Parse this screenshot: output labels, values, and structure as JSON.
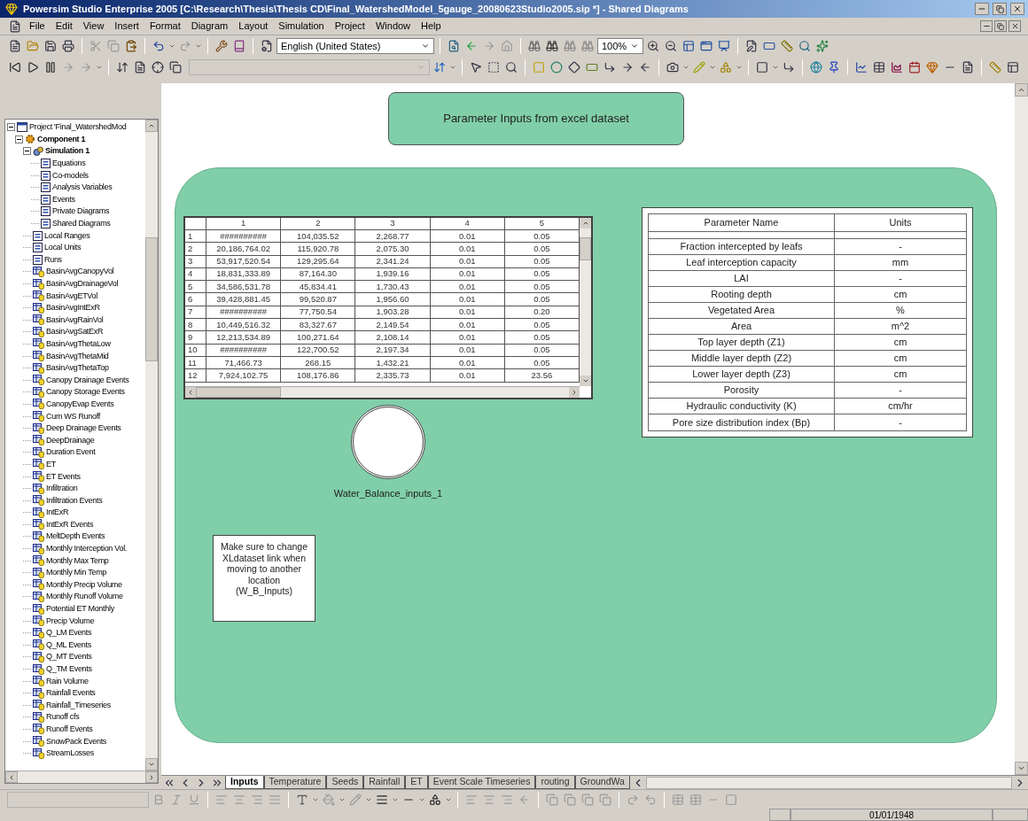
{
  "window": {
    "title": "Powersim Studio Enterprise 2005 [C:\\Research\\Thesis\\Thesis CD\\Final_WatershedModel_5gauge_20080623Studio2005.sip *] - Shared Diagrams"
  },
  "menu": [
    "File",
    "Edit",
    "View",
    "Insert",
    "Format",
    "Diagram",
    "Layout",
    "Simulation",
    "Project",
    "Window",
    "Help"
  ],
  "toolbar": {
    "language": "English (United States)",
    "zoom": "100%"
  },
  "project_tree": [
    {
      "label": "Project 'Final_WatershedMod",
      "kind": "project",
      "expanded": true,
      "children": [
        {
          "label": "Component 1",
          "kind": "component",
          "expanded": true,
          "children": [
            {
              "label": "Simulation 1",
              "kind": "simulation",
              "expanded": true,
              "children": [
                {
                  "label": "Equations",
                  "kind": "item"
                },
                {
                  "label": "Co-models",
                  "kind": "item"
                },
                {
                  "label": "Analysis Variables",
                  "kind": "item"
                },
                {
                  "label": "Events",
                  "kind": "item"
                },
                {
                  "label": "Private Diagrams",
                  "kind": "item"
                },
                {
                  "label": "Shared Diagrams",
                  "kind": "item"
                }
              ]
            },
            {
              "label": "Local Ranges",
              "kind": "item"
            },
            {
              "label": "Local Units",
              "kind": "item"
            },
            {
              "label": "Runs",
              "kind": "item"
            },
            {
              "label": "BasinAvgCanopyVol",
              "kind": "variable"
            },
            {
              "label": "BasinAvgDrainageVol",
              "kind": "variable"
            },
            {
              "label": "BasinAvgETVol",
              "kind": "variable"
            },
            {
              "label": "BasinAvgIntExR",
              "kind": "variable"
            },
            {
              "label": "BasinAvgRainVol",
              "kind": "variable"
            },
            {
              "label": "BasinAvgSatExR",
              "kind": "variable"
            },
            {
              "label": "BasinAvgThetaLow",
              "kind": "variable"
            },
            {
              "label": "BasinAvgThetaMid",
              "kind": "variable"
            },
            {
              "label": "BasinAvgThetaTop",
              "kind": "variable"
            },
            {
              "label": "Canopy Drainage Events",
              "kind": "variable"
            },
            {
              "label": "Canopy Storage Events",
              "kind": "variable"
            },
            {
              "label": "CanopyEvap Events",
              "kind": "variable"
            },
            {
              "label": "Cum WS Runoff",
              "kind": "variable"
            },
            {
              "label": "Deep Drainage Events",
              "kind": "variable"
            },
            {
              "label": "DeepDrainage",
              "kind": "variable"
            },
            {
              "label": "Duration Event",
              "kind": "variable"
            },
            {
              "label": "ET",
              "kind": "variable"
            },
            {
              "label": "ET Events",
              "kind": "variable"
            },
            {
              "label": "Infiltration",
              "kind": "variable"
            },
            {
              "label": "Infiltration Events",
              "kind": "variable"
            },
            {
              "label": "IntExR",
              "kind": "variable"
            },
            {
              "label": "IntExR Events",
              "kind": "variable"
            },
            {
              "label": "MeltDepth Events",
              "kind": "variable"
            },
            {
              "label": "Monthly Interception Vol.",
              "kind": "variable"
            },
            {
              "label": "Monthly Max Temp",
              "kind": "variable"
            },
            {
              "label": "Monthly Min Temp",
              "kind": "variable"
            },
            {
              "label": "Monthly Precip Volume",
              "kind": "variable"
            },
            {
              "label": "Monthly Runoff Volume",
              "kind": "variable"
            },
            {
              "label": "Potential ET Monthly",
              "kind": "variable"
            },
            {
              "label": "Precip Volume",
              "kind": "variable"
            },
            {
              "label": "Q_LM Events",
              "kind": "variable"
            },
            {
              "label": "Q_ML Events",
              "kind": "variable"
            },
            {
              "label": "Q_MT Events",
              "kind": "variable"
            },
            {
              "label": "Q_TM Events",
              "kind": "variable"
            },
            {
              "label": "Rain Volume",
              "kind": "variable"
            },
            {
              "label": "Rainfall Events",
              "kind": "variable"
            },
            {
              "label": "Rainfall_Timeseries",
              "kind": "variable"
            },
            {
              "label": "Runoff cfs",
              "kind": "variable"
            },
            {
              "label": "Runoff Events",
              "kind": "variable"
            },
            {
              "label": "SnowPack Events",
              "kind": "variable"
            },
            {
              "label": "StreamLosses",
              "kind": "variable"
            }
          ]
        }
      ]
    }
  ],
  "diagram": {
    "title_box": "Parameter Inputs from excel dataset",
    "data_table": {
      "columns": [
        "1",
        "2",
        "3",
        "4",
        "5"
      ],
      "rows": [
        {
          "index": "1",
          "cells": [
            "##########",
            "104,035.52",
            "2,268.77",
            "0.01",
            "0.05"
          ]
        },
        {
          "index": "2",
          "cells": [
            "20,186,764.02",
            "115,920.78",
            "2,075.30",
            "0.01",
            "0.05"
          ]
        },
        {
          "index": "3",
          "cells": [
            "53,917,520.54",
            "129,295.64",
            "2,341.24",
            "0.01",
            "0.05"
          ]
        },
        {
          "index": "4",
          "cells": [
            "18,831,333.89",
            "87,164.30",
            "1,939.16",
            "0.01",
            "0.05"
          ]
        },
        {
          "index": "5",
          "cells": [
            "34,586,531.78",
            "45,834.41",
            "1,730.43",
            "0.01",
            "0.05"
          ]
        },
        {
          "index": "6",
          "cells": [
            "39,428,881.45",
            "99,520.87",
            "1,956.60",
            "0.01",
            "0.05"
          ]
        },
        {
          "index": "7",
          "cells": [
            "##########",
            "77,750.54",
            "1,903.28",
            "0.01",
            "0.20"
          ]
        },
        {
          "index": "8",
          "cells": [
            "10,449,516.32",
            "83,327.67",
            "2,149.54",
            "0.01",
            "0.05"
          ]
        },
        {
          "index": "9",
          "cells": [
            "12,213,534.89",
            "100,271.64",
            "2,108.14",
            "0.01",
            "0.05"
          ]
        },
        {
          "index": "10",
          "cells": [
            "##########",
            "122,700.52",
            "2,197.34",
            "0.01",
            "0.05"
          ]
        },
        {
          "index": "11",
          "cells": [
            "71,466.73",
            "268.15",
            "1,432.21",
            "0.01",
            "0.05"
          ]
        },
        {
          "index": "12",
          "cells": [
            "7,924,102.75",
            "108,176.86",
            "2,335.73",
            "0.01",
            "23.56"
          ]
        }
      ]
    },
    "node_label": "Water_Balance_inputs_1",
    "note": "Make sure to change XLdataset link when moving to another location (W_B_Inputs)",
    "parameter_table": {
      "columns": [
        "Parameter Name",
        "Units"
      ],
      "rows": [
        [
          "Fraction intercepted by leafs",
          "-"
        ],
        [
          "Leaf interception capacity",
          "mm"
        ],
        [
          "LAI",
          "-"
        ],
        [
          "Rooting depth",
          "cm"
        ],
        [
          "Vegetated Area",
          "%"
        ],
        [
          "Area",
          "m^2"
        ],
        [
          "Top layer depth (Z1)",
          "cm"
        ],
        [
          "Middle layer depth (Z2)",
          "cm"
        ],
        [
          "Lower layer depth (Z3)",
          "cm"
        ],
        [
          "Porosity",
          "-"
        ],
        [
          "Hydraulic conductivity (K)",
          "cm/hr"
        ],
        [
          "Pore size distribution index (Bp)",
          "-"
        ]
      ]
    }
  },
  "sheet_tabs": [
    {
      "label": "Inputs",
      "selected": true
    },
    {
      "label": "Temperature",
      "selected": false
    },
    {
      "label": "Seeds",
      "selected": false
    },
    {
      "label": "Rainfall",
      "selected": false
    },
    {
      "label": "ET",
      "selected": false
    },
    {
      "label": "Event Scale Timeseries",
      "selected": false
    },
    {
      "label": "routing",
      "selected": false
    },
    {
      "label": "GroundWa",
      "selected": false
    }
  ],
  "status_bar": {
    "date": "01/01/1948"
  }
}
